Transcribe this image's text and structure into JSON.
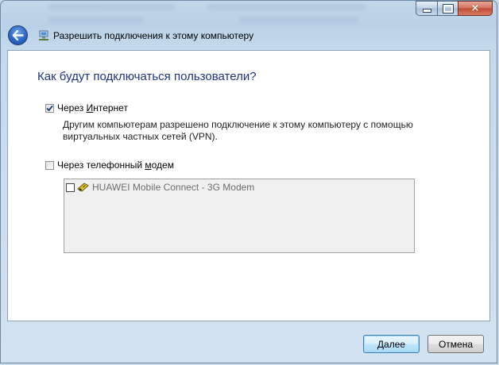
{
  "window": {
    "title": "Разрешить подключения к этому компьютеру",
    "controls": {
      "minimize": "minimize",
      "maximize": "maximize",
      "close": "×"
    }
  },
  "main": {
    "heading": "Как будут подключаться пользователи?",
    "option_internet": {
      "label_pre": "Через ",
      "label_accel": "И",
      "label_post": "нтернет",
      "checked": true,
      "description": "Другим компьютерам разрешено подключение к этому компьютеру с помощью виртуальных частных сетей (VPN)."
    },
    "option_modem": {
      "label_pre": "Через телефонный ",
      "label_accel": "м",
      "label_post": "одем",
      "checked": false
    },
    "modems": [
      {
        "label": "HUAWEI Mobile Connect - 3G Modem",
        "checked": false,
        "icon": "modem-icon"
      }
    ]
  },
  "footer": {
    "next_label": "Далее",
    "cancel_label": "Отмена"
  },
  "colors": {
    "heading": "#1e3287",
    "accent": "#3c7fb1"
  }
}
